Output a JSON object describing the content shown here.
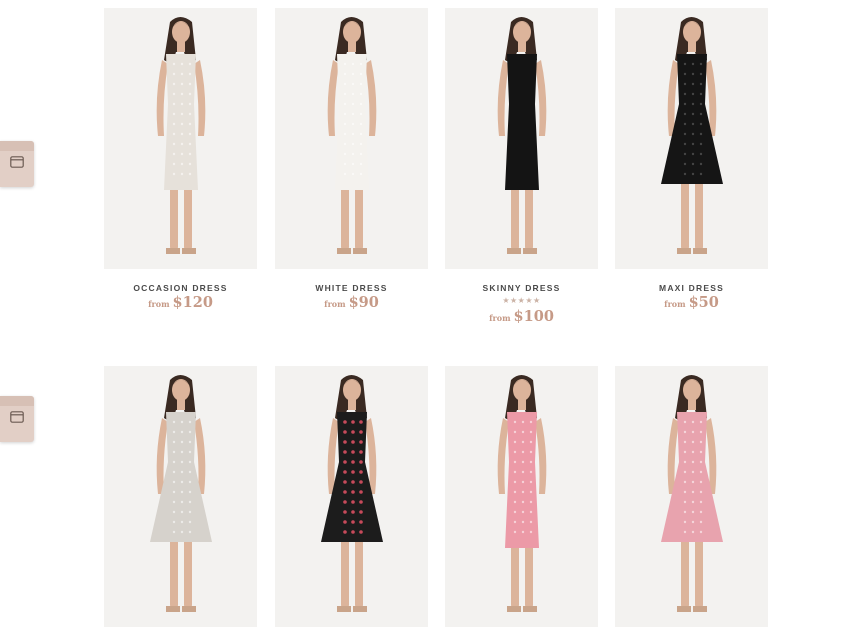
{
  "side_tabs": [
    {
      "icon": "browser-window-icon"
    },
    {
      "icon": "browser-window-icon"
    }
  ],
  "products": [
    {
      "name": "OCCASION DRESS",
      "from": "from",
      "price": "$120",
      "dress_color": "#e6e1da",
      "pattern": "lace"
    },
    {
      "name": "WHITE DRESS",
      "from": "from",
      "price": "$90",
      "dress_color": "#f4f2ee",
      "pattern": "lace"
    },
    {
      "name": "SKINNY DRESS",
      "from": "from",
      "price": "$100",
      "stars": "★★★★★",
      "dress_color": "#141414",
      "pattern": "plain"
    },
    {
      "name": "MAXI DRESS",
      "from": "from",
      "price": "$50",
      "dress_color": "#151515",
      "pattern": "dots"
    },
    {
      "name": "",
      "dress_color": "#d6d2cc",
      "pattern": "lace"
    },
    {
      "name": "",
      "dress_color": "#1c1c1c",
      "pattern": "floral"
    },
    {
      "name": "",
      "dress_color": "#ec9aa7",
      "pattern": "mesh"
    },
    {
      "name": "",
      "dress_color": "#e8a3ae",
      "pattern": "mesh"
    }
  ],
  "colors": {
    "price": "#c69a87",
    "tab": "#e2cfc6",
    "photo_bg": "#f3f2f0",
    "skin": "#dcb49b",
    "hair": "#3a2a22"
  }
}
